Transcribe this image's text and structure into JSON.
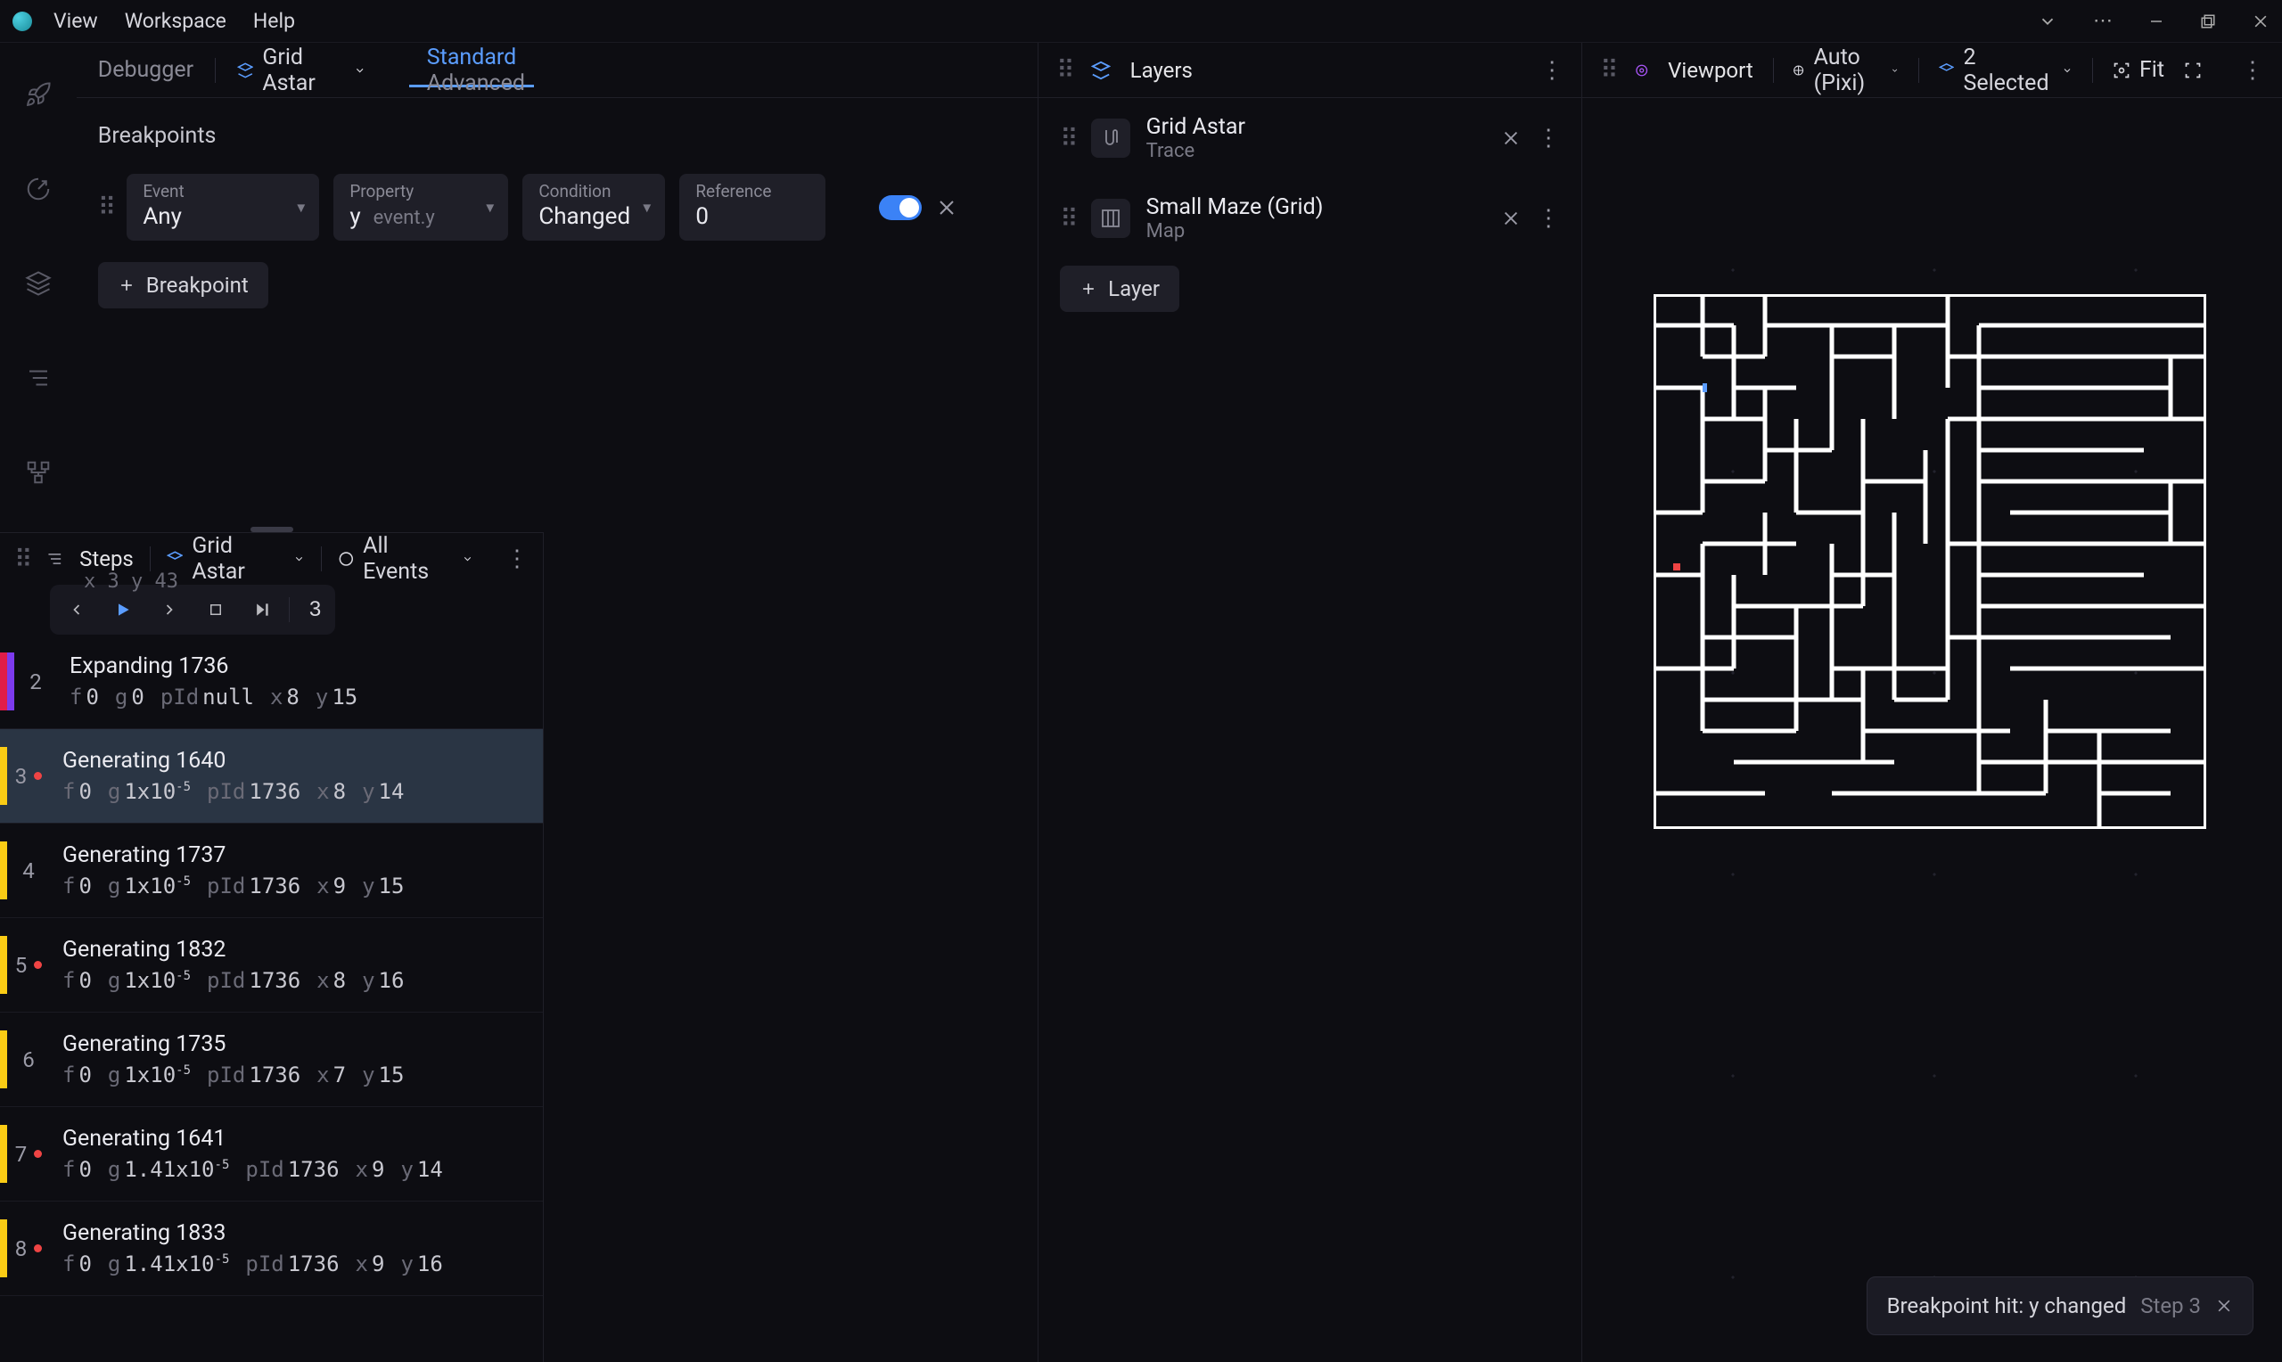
{
  "menubar": [
    "View",
    "Workspace",
    "Help"
  ],
  "leftPanel": {
    "headerLabel": "Debugger",
    "algorithm": "Grid Astar",
    "tabs": {
      "standard": "Standard",
      "advanced": "Advanced"
    },
    "section": "Breakpoints",
    "breakpoint": {
      "eventLabel": "Event",
      "eventValue": "Any",
      "propLabel": "Property",
      "propValue": "y",
      "propSub": "event.y",
      "condLabel": "Condition",
      "condValue": "Changed",
      "refLabel": "Reference",
      "refValue": "0"
    },
    "addBreakpoint": "Breakpoint"
  },
  "layers": {
    "headerLeft": "Layers",
    "items": [
      {
        "title": "Grid Astar",
        "sub": "Trace"
      },
      {
        "title": "Small Maze (Grid)",
        "sub": "Map"
      }
    ],
    "addLayer": "Layer"
  },
  "viewportHeader": {
    "viewport": "Viewport",
    "renderer": "Auto (Pixi)",
    "selection": "2 Selected",
    "fit": "Fit"
  },
  "steps": {
    "header": "Steps",
    "algorithm": "Grid Astar",
    "filter": "All Events",
    "currentStep": "3",
    "topClipped": {
      "meta": "x 3  y 43"
    },
    "rows": [
      {
        "n": "2",
        "gutter": "#e11d48,#7c3aed",
        "dot": false,
        "title": "Expanding 1736",
        "f": "0",
        "g": "0",
        "gExp": "",
        "pId": "null",
        "x": "8",
        "y": "15"
      },
      {
        "n": "3",
        "gutter": "#facc15",
        "dot": true,
        "selected": true,
        "title": "Generating 1640",
        "f": "0",
        "g": "1x10",
        "gExp": "-5",
        "pId": "1736",
        "x": "8",
        "y": "14"
      },
      {
        "n": "4",
        "gutter": "#facc15",
        "dot": false,
        "title": "Generating 1737",
        "f": "0",
        "g": "1x10",
        "gExp": "-5",
        "pId": "1736",
        "x": "9",
        "y": "15"
      },
      {
        "n": "5",
        "gutter": "#facc15",
        "dot": true,
        "title": "Generating 1832",
        "f": "0",
        "g": "1x10",
        "gExp": "-5",
        "pId": "1736",
        "x": "8",
        "y": "16"
      },
      {
        "n": "6",
        "gutter": "#facc15",
        "dot": false,
        "title": "Generating 1735",
        "f": "0",
        "g": "1x10",
        "gExp": "-5",
        "pId": "1736",
        "x": "7",
        "y": "15"
      },
      {
        "n": "7",
        "gutter": "#facc15",
        "dot": true,
        "title": "Generating 1641",
        "f": "0",
        "g": "1.41x10",
        "gExp": "-5",
        "pId": "1736",
        "x": "9",
        "y": "14"
      },
      {
        "n": "8",
        "gutter": "#facc15",
        "dot": true,
        "title": "Generating 1833",
        "f": "0",
        "g": "1.41x10",
        "gExp": "-5",
        "pId": "1736",
        "x": "9",
        "y": "16"
      }
    ]
  },
  "toast": {
    "message": "Breakpoint hit: y changed",
    "step": "Step 3"
  }
}
